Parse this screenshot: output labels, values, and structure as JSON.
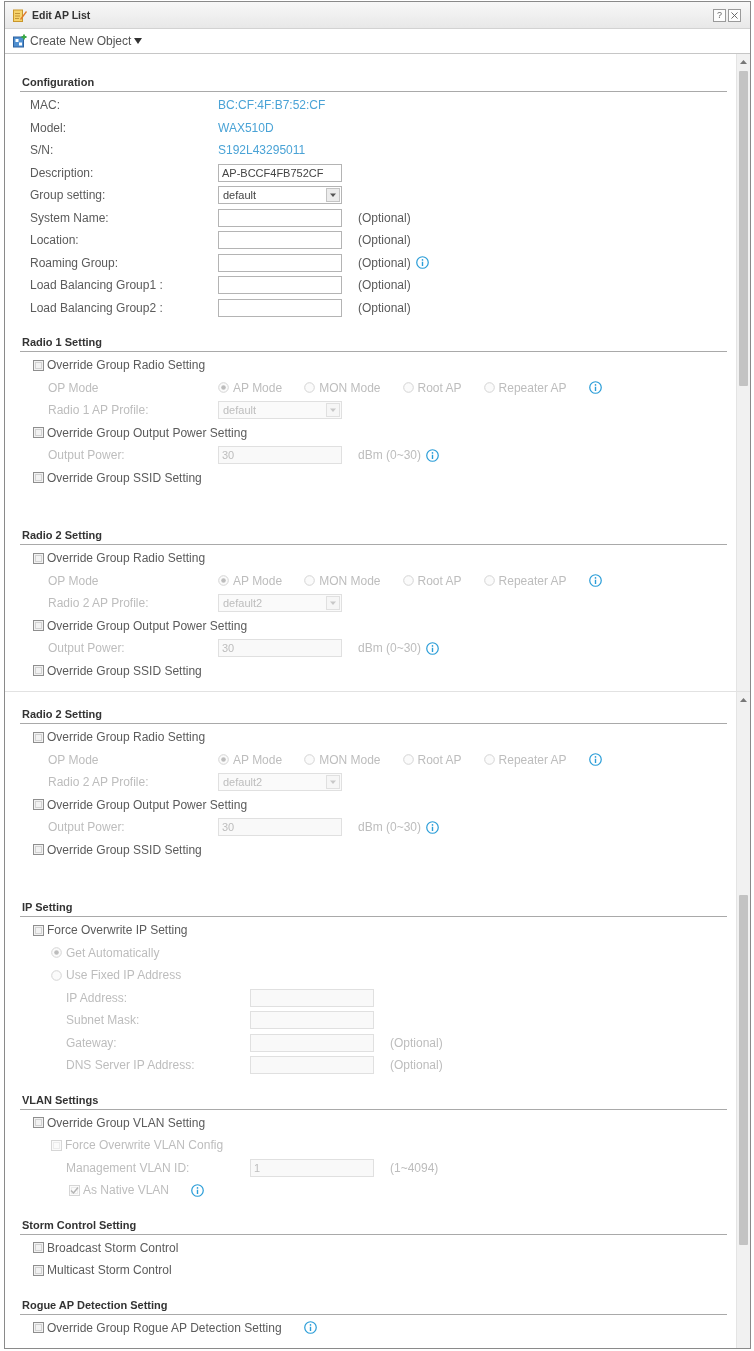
{
  "window": {
    "title": "Edit AP List",
    "help": "?"
  },
  "toolbar": {
    "menu": "Create New Object"
  },
  "panels": [
    {
      "sections": [
        {
          "title": "Configuration",
          "rows": [
            {
              "kind": "info",
              "label": "MAC:",
              "value": "BC:CF:4F:B7:52:CF"
            },
            {
              "kind": "info",
              "label": "Model:",
              "value": "WAX510D"
            },
            {
              "kind": "info",
              "label": "S/N:",
              "value": "S192L43295011"
            },
            {
              "kind": "field",
              "label": "Description:",
              "value": "AP-BCCF4FB752CF",
              "disabled": false
            },
            {
              "kind": "select",
              "label": "Group setting:",
              "value": "default",
              "disabled": false
            },
            {
              "kind": "field",
              "label": "System Name:",
              "note": "(Optional)",
              "disabled": false
            },
            {
              "kind": "field",
              "label": "Location:",
              "note": "(Optional)",
              "disabled": false
            },
            {
              "kind": "field",
              "label": "Roaming Group:",
              "note": "(Optional)",
              "info": true,
              "disabled": false
            },
            {
              "kind": "field",
              "label": "Load Balancing Group1 :",
              "note": "(Optional)",
              "disabled": false
            },
            {
              "kind": "field",
              "label": "Load Balancing Group2 :",
              "note": "(Optional)",
              "disabled": false
            }
          ]
        },
        {
          "title": "Radio 1 Setting",
          "rows": [
            {
              "kind": "checkbox",
              "label": "Override Group Radio Setting",
              "checked": false,
              "disabled": false,
              "children": [
                {
                  "kind": "options",
                  "label": "OP Mode",
                  "disabled": true,
                  "info": true,
                  "options": [
                    {
                      "label": "AP Mode",
                      "selected": true
                    },
                    {
                      "label": "MON Mode",
                      "selected": false
                    },
                    {
                      "label": "Root AP",
                      "selected": false
                    },
                    {
                      "label": "Repeater AP",
                      "selected": false
                    }
                  ]
                },
                {
                  "kind": "select",
                  "label": "Radio 1 AP Profile:",
                  "value": "default",
                  "disabled": true
                }
              ]
            },
            {
              "kind": "checkbox",
              "label": "Override Group Output Power Setting",
              "checked": false,
              "disabled": false,
              "children": [
                {
                  "kind": "field",
                  "label": "Output Power:",
                  "value": "30",
                  "note": "dBm (0~30)",
                  "info": true,
                  "disabled": true
                }
              ]
            },
            {
              "kind": "checkbox",
              "label": "Override Group SSID Setting",
              "checked": false,
              "disabled": false
            }
          ]
        },
        {
          "title": "Radio 2 Setting",
          "rows": [
            {
              "kind": "checkbox",
              "label": "Override Group Radio Setting",
              "checked": false,
              "disabled": false,
              "children": [
                {
                  "kind": "options",
                  "label": "OP Mode",
                  "disabled": true,
                  "info": true,
                  "options": [
                    {
                      "label": "AP Mode",
                      "selected": true
                    },
                    {
                      "label": "MON Mode",
                      "selected": false
                    },
                    {
                      "label": "Root AP",
                      "selected": false
                    },
                    {
                      "label": "Repeater AP",
                      "selected": false
                    }
                  ]
                },
                {
                  "kind": "select",
                  "label": "Radio 2 AP Profile:",
                  "value": "default2",
                  "disabled": true
                }
              ]
            },
            {
              "kind": "checkbox",
              "label": "Override Group Output Power Setting",
              "checked": false,
              "disabled": false,
              "children": [
                {
                  "kind": "field",
                  "label": "Output Power:",
                  "value": "30",
                  "note": "dBm (0~30)",
                  "info": true,
                  "disabled": true
                }
              ]
            },
            {
              "kind": "checkbox",
              "label": "Override Group SSID Setting",
              "checked": false,
              "disabled": false
            }
          ]
        }
      ]
    },
    {
      "sections": [
        {
          "title": "Radio 2 Setting",
          "rows": [
            {
              "kind": "checkbox",
              "label": "Override Group Radio Setting",
              "checked": false,
              "disabled": false,
              "children": [
                {
                  "kind": "options",
                  "label": "OP Mode",
                  "disabled": true,
                  "info": true,
                  "options": [
                    {
                      "label": "AP Mode",
                      "selected": true
                    },
                    {
                      "label": "MON Mode",
                      "selected": false
                    },
                    {
                      "label": "Root AP",
                      "selected": false
                    },
                    {
                      "label": "Repeater AP",
                      "selected": false
                    }
                  ]
                },
                {
                  "kind": "select",
                  "label": "Radio 2 AP Profile:",
                  "value": "default2",
                  "disabled": true
                }
              ]
            },
            {
              "kind": "checkbox",
              "label": "Override Group Output Power Setting",
              "checked": false,
              "disabled": false,
              "children": [
                {
                  "kind": "field",
                  "label": "Output Power:",
                  "value": "30",
                  "note": "dBm (0~30)",
                  "info": true,
                  "disabled": true
                }
              ]
            },
            {
              "kind": "checkbox",
              "label": "Override Group SSID Setting",
              "checked": false,
              "disabled": false
            }
          ]
        },
        {
          "title": "IP Setting",
          "rows": [
            {
              "kind": "checkbox",
              "label": "Force Overwrite IP Setting",
              "checked": false,
              "disabled": false,
              "children": [
                {
                  "kind": "radio",
                  "label": "Get Automatically",
                  "selected": true,
                  "disabled": true
                },
                {
                  "kind": "radio",
                  "label": "Use Fixed IP Address",
                  "selected": false,
                  "disabled": true,
                  "children": [
                    {
                      "kind": "field",
                      "label": "IP Address:",
                      "disabled": true
                    },
                    {
                      "kind": "field",
                      "label": "Subnet Mask:",
                      "disabled": true
                    },
                    {
                      "kind": "field",
                      "label": "Gateway:",
                      "note": "(Optional)",
                      "disabled": true
                    },
                    {
                      "kind": "field",
                      "label": "DNS Server IP Address:",
                      "note": "(Optional)",
                      "disabled": true
                    }
                  ]
                }
              ]
            }
          ]
        },
        {
          "title": "VLAN Settings",
          "rows": [
            {
              "kind": "checkbox",
              "label": "Override Group VLAN Setting",
              "checked": false,
              "disabled": false,
              "children": [
                {
                  "kind": "checkbox",
                  "label": "Force Overwrite VLAN Config",
                  "checked": false,
                  "disabled": true,
                  "children": [
                    {
                      "kind": "field",
                      "label": "Management VLAN ID:",
                      "value": "1",
                      "note": "(1~4094)",
                      "disabled": true
                    },
                    {
                      "kind": "checkbox",
                      "label": "As Native VLAN",
                      "checked": true,
                      "disabled": true,
                      "info": true
                    }
                  ]
                }
              ]
            }
          ]
        },
        {
          "title": "Storm Control Setting",
          "rows": [
            {
              "kind": "checkbox",
              "label": "Broadcast Storm Control",
              "checked": false,
              "disabled": false
            },
            {
              "kind": "checkbox",
              "label": "Multicast Storm Control",
              "checked": false,
              "disabled": false
            }
          ]
        },
        {
          "title": "Rogue AP Detection Setting",
          "rows": [
            {
              "kind": "checkbox",
              "label": "Override Group Rogue AP Detection Setting",
              "checked": false,
              "disabled": false,
              "info": true
            }
          ]
        }
      ]
    }
  ]
}
